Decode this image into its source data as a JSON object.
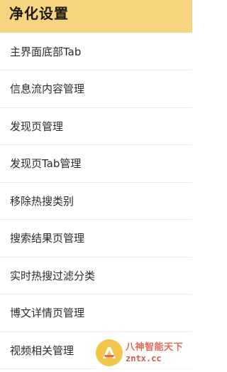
{
  "header": {
    "title": "净化设置"
  },
  "menu": {
    "items": [
      {
        "label": "主界面底部Tab"
      },
      {
        "label": "信息流内容管理"
      },
      {
        "label": "发现页管理"
      },
      {
        "label": "发现页Tab管理"
      },
      {
        "label": "移除热搜类别"
      },
      {
        "label": "搜索结果页管理"
      },
      {
        "label": "实时热搜过滤分类"
      },
      {
        "label": "博文详情页管理"
      },
      {
        "label": "视频相关管理"
      }
    ]
  },
  "watermark": {
    "title": "八神智能天下",
    "url": "zntx.cc"
  },
  "colors": {
    "header_bg": "#f5d67e",
    "divider": "#ececec",
    "watermark_text": "#e06a5a"
  }
}
